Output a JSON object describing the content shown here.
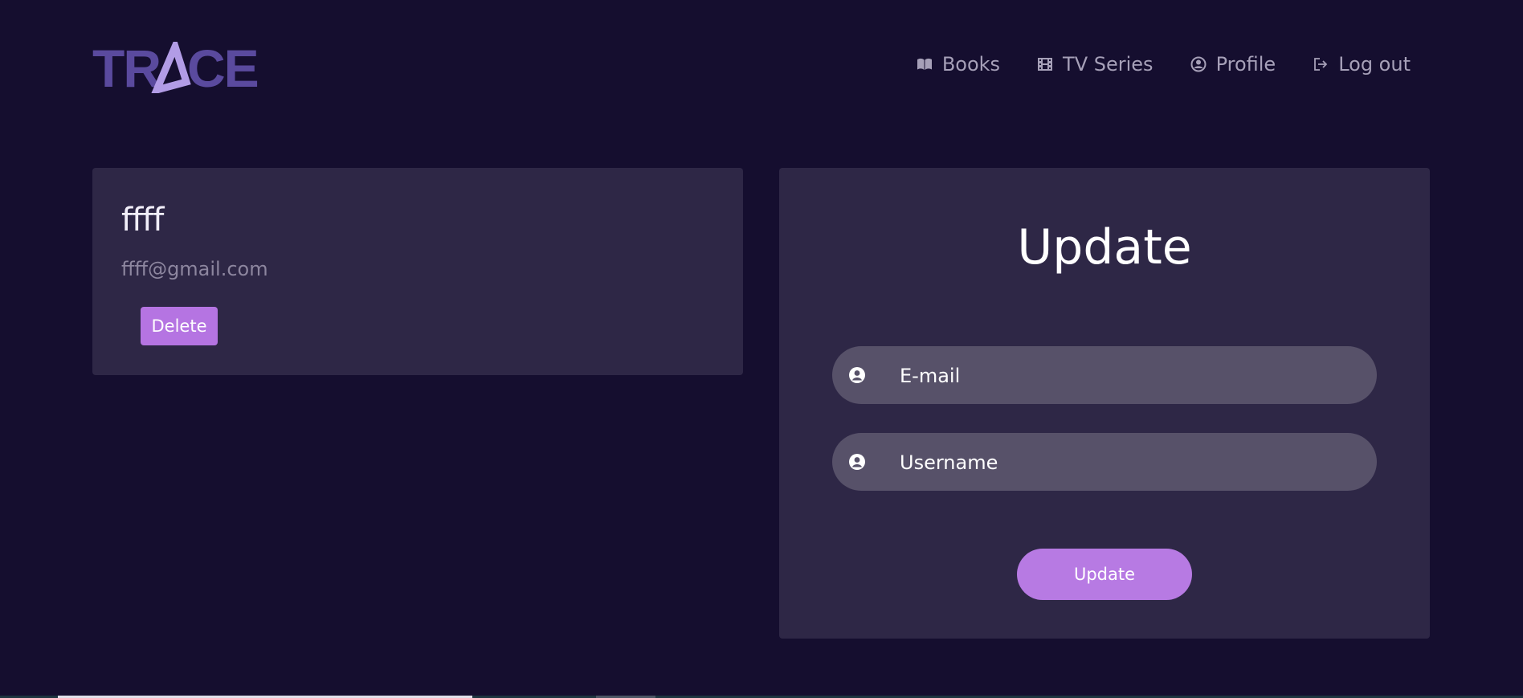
{
  "header": {
    "logo_text": "TRACE",
    "nav": [
      {
        "label": "Books",
        "icon": "book-icon"
      },
      {
        "label": "TV Series",
        "icon": "film-icon"
      },
      {
        "label": "Profile",
        "icon": "user-circle-icon"
      },
      {
        "label": "Log out",
        "icon": "logout-icon"
      }
    ]
  },
  "profile": {
    "name": "ffff",
    "email": "ffff@gmail.com",
    "delete_label": "Delete"
  },
  "update_form": {
    "title": "Update",
    "email_placeholder": "E-mail",
    "username_placeholder": "Username",
    "submit_label": "Update"
  },
  "colors": {
    "background": "#150e2f",
    "card": "#2e2746",
    "input": "#575169",
    "accent": "#b77ae3",
    "logo": "#5a4a9e",
    "logo_triangle": "#b29ce6",
    "nav_text": "#a6a0b8"
  }
}
